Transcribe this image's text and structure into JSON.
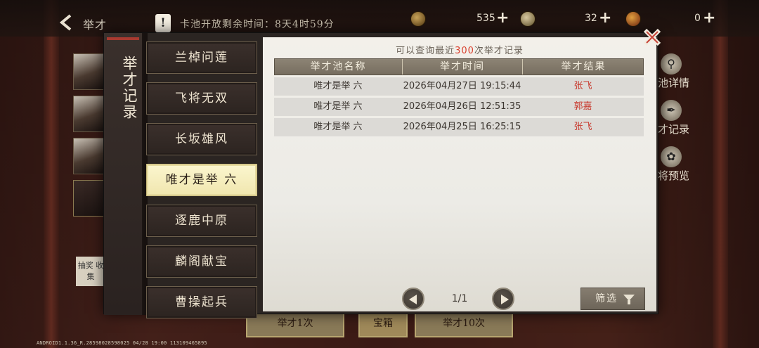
{
  "topbar": {
    "back_label": "举才",
    "notice_icon": "!",
    "pool_timer": "卡池开放剩余时间：8天4时59分",
    "currencies": [
      {
        "value": "535",
        "icon": "coin-icon"
      },
      {
        "value": "32",
        "icon": "gem-icon"
      },
      {
        "value": "0",
        "icon": "token-icon"
      }
    ]
  },
  "side": {
    "lottery_note": "抽奖 收集"
  },
  "right_menu": {
    "items": [
      {
        "label": "池详情",
        "icon": "magnifier-icon"
      },
      {
        "label": "才记录",
        "icon": "brush-icon"
      },
      {
        "label": "将预览",
        "icon": "swirl-icon"
      }
    ]
  },
  "bottom": {
    "left_label": "举才1次",
    "mid_label": "宝箱",
    "right_label": "举才10次"
  },
  "dialog": {
    "title": "举才记录",
    "tabs": [
      {
        "label": "兰棹问莲",
        "active": false
      },
      {
        "label": "飞将无双",
        "active": false
      },
      {
        "label": "长坂雄风",
        "active": false
      },
      {
        "label": "唯才是举 六",
        "active": true
      },
      {
        "label": "逐鹿中原",
        "active": false
      },
      {
        "label": "麟阁献宝",
        "active": false
      },
      {
        "label": "曹操起兵",
        "active": false
      }
    ],
    "hint_prefix": "可以查询最近",
    "hint_count": "300",
    "hint_suffix": "次举才记录",
    "table": {
      "headers": [
        "举才池名称",
        "举才时间",
        "举才结果"
      ],
      "rows": [
        {
          "pool": "唯才是举 六",
          "time": "2026年04月27日 19:15:44",
          "result": "张飞"
        },
        {
          "pool": "唯才是举 六",
          "time": "2026年04月26日 12:51:35",
          "result": "郭嘉"
        },
        {
          "pool": "唯才是举 六",
          "time": "2026年04月25日 16:25:15",
          "result": "张飞"
        }
      ]
    },
    "pager": {
      "page": "1/1"
    },
    "filter_label": "筛选",
    "accent_red": "#d9402e"
  },
  "version": "ANDROID1.1.36_R.28598028598025 04/28 19:00 113109465895"
}
